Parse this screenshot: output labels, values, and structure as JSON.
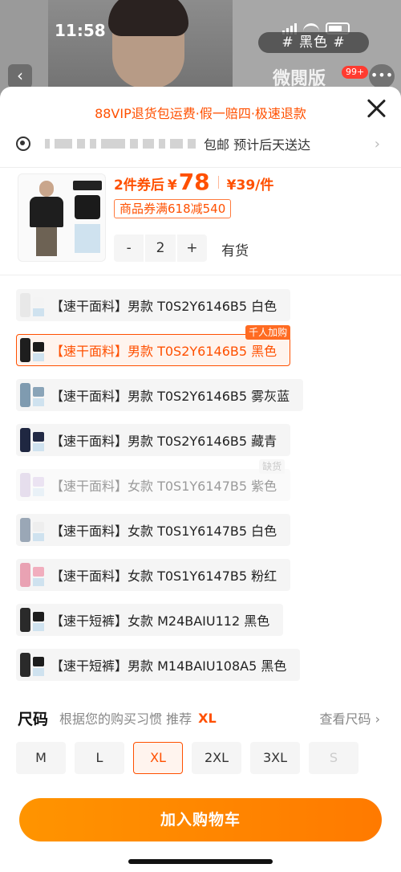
{
  "status_bar": {
    "time": "11:58"
  },
  "background": {
    "tag": "# 黑色 #",
    "brand": "微閱版",
    "cart_badge": "99+"
  },
  "sheet": {
    "promo": "88VIP退货包运费·假一赔四·极速退款",
    "shipping": {
      "text": "包邮 预计后天送达"
    },
    "product": {
      "price_prefix": "2件券后",
      "price_symbol": "¥",
      "price_value": "78",
      "price_each": "¥39/件",
      "coupon": "商品券满618减540",
      "quantity": "2",
      "stock": "有货",
      "decrement": "-",
      "increment": "+"
    },
    "variants": [
      {
        "label": "【速干面料】男款 T0S2Y6146B5 白色",
        "state": "normal",
        "badge": "",
        "colors": [
          "#e8e8e8",
          "#f4f4f4"
        ]
      },
      {
        "label": "【速干面料】男款 T0S2Y6146B5 黑色",
        "state": "selected",
        "badge": "千人加购",
        "colors": [
          "#1e1e1e",
          "#1b1b1b"
        ]
      },
      {
        "label": "【速干面料】男款 T0S2Y6146B5 雾灰蓝",
        "state": "normal",
        "badge": "",
        "colors": [
          "#7f9bb0",
          "#8aa4b8"
        ]
      },
      {
        "label": "【速干面料】男款 T0S2Y6146B5 藏青",
        "state": "normal",
        "badge": "",
        "colors": [
          "#1f2741",
          "#222a45"
        ]
      },
      {
        "label": "【速干面料】女款 T0S1Y6147B5 紫色",
        "state": "disabled",
        "badge": "缺货",
        "colors": [
          "#c9b7d9",
          "#d4c2e3"
        ]
      },
      {
        "label": "【速干面料】女款 T0S1Y6147B5 白色",
        "state": "normal",
        "badge": "",
        "colors": [
          "#9aa7b6",
          "#eeeeee"
        ]
      },
      {
        "label": "【速干面料】女款 T0S1Y6147B5 粉红",
        "state": "normal",
        "badge": "",
        "colors": [
          "#e9a2b3",
          "#f1aebe"
        ]
      },
      {
        "label": "【速干短裤】女款 M24BAIU112 黑色",
        "state": "normal",
        "badge": "",
        "colors": [
          "#2a2a2a",
          "#1d1d1d"
        ]
      },
      {
        "label": "【速干短裤】男款 M14BAIU108A5 黑色",
        "state": "normal",
        "badge": "",
        "colors": [
          "#2a2a2a",
          "#1d1d1d"
        ]
      }
    ],
    "size_section": {
      "title": "尺码",
      "hint": "根据您的购买习惯 推荐",
      "recommended": "XL",
      "chart_link": "查看尺码 ›",
      "sizes": [
        {
          "label": "M",
          "state": "normal"
        },
        {
          "label": "L",
          "state": "normal"
        },
        {
          "label": "XL",
          "state": "selected"
        },
        {
          "label": "2XL",
          "state": "normal"
        },
        {
          "label": "3XL",
          "state": "normal"
        },
        {
          "label": "S",
          "state": "disabled"
        }
      ]
    },
    "cart_button": "加入购物车"
  },
  "colors": {
    "accent": "#ff5000",
    "button": "#ff8a00"
  }
}
